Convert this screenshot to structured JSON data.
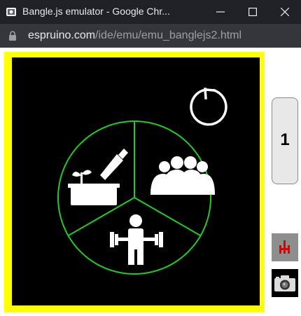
{
  "window": {
    "title": "Bangle.js emulator - Google Chr...",
    "minimize_icon": "minimize-icon",
    "maximize_icon": "maximize-icon",
    "close_icon": "close-icon"
  },
  "addressbar": {
    "host": "espruino.com",
    "path": "/ide/emu/emu_banglejs2.html",
    "lock_icon": "lock-icon"
  },
  "watch": {
    "frame_color": "#ffff00",
    "screen_color": "#000000",
    "ring_color": "#22cc22",
    "icons": [
      "reload-icon",
      "gardening-icon",
      "group-icon",
      "weightlifting-icon"
    ]
  },
  "side_button": {
    "label": "1"
  },
  "tools": [
    "accelerometer-icon",
    "camera-icon"
  ]
}
